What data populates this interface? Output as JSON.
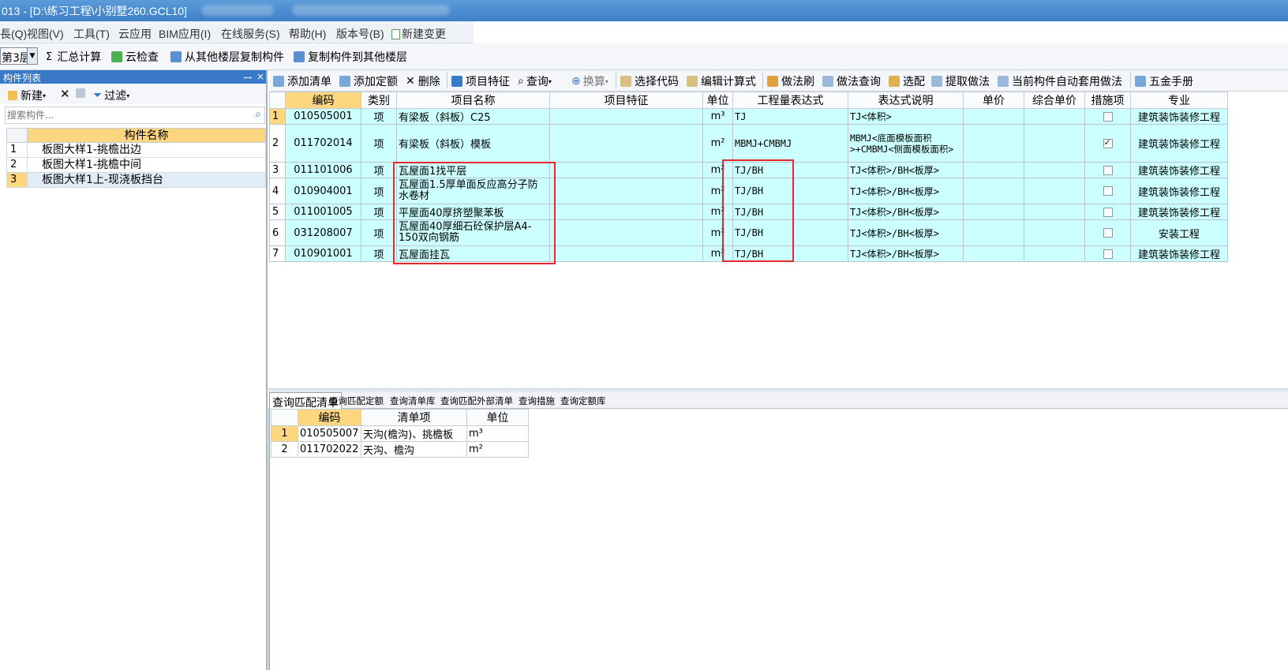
{
  "window": {
    "title": "013 - [D:\\练习工程\\小别墅260.GCL10]"
  },
  "menu": [
    "長(Q)",
    "视图(V)",
    "工具(T)",
    "云应用",
    "BIM应用(I)",
    "在线服务(S)",
    "帮助(H)",
    "版本号(B)",
    "新建变更"
  ],
  "toolbar1": {
    "floor": "第3层",
    "items": [
      "汇总计算",
      "云检查",
      "从其他楼层复制构件",
      "复制构件到其他楼层"
    ],
    "sum_symbol": "Σ"
  },
  "left_panel": {
    "title": "构件列表",
    "pin": "ꟷ",
    "close": "×",
    "new_label": "新建",
    "filter_label": "过滤",
    "search_placeholder": "搜索构件...",
    "column_header": "构件名称",
    "rows": [
      {
        "no": "1",
        "name": "板图大样1-挑檐出边"
      },
      {
        "no": "2",
        "name": "板图大样1-挑檐中间"
      },
      {
        "no": "3",
        "name": "板图大样1上-现浇板挡台"
      }
    ]
  },
  "main_toolbar": {
    "items": [
      "添加清单",
      "添加定额",
      "删除",
      "项目特征",
      "查询",
      "换算",
      "选择代码",
      "编辑计算式",
      "做法刷",
      "做法查询",
      "选配",
      "提取做法",
      "当前构件自动套用做法",
      "五金手册"
    ]
  },
  "main_grid": {
    "columns": [
      "编码",
      "类别",
      "项目名称",
      "项目特征",
      "单位",
      "工程量表达式",
      "表达式说明",
      "单价",
      "综合单价",
      "措施项",
      "专业"
    ],
    "rows": [
      {
        "no": "1",
        "code": "010505001",
        "type": "项",
        "name": "有梁板（斜板）C25",
        "feature": "",
        "unit": "m³",
        "expr": "TJ",
        "desc": "TJ<体积>",
        "price": "",
        "comp": "",
        "measure": false,
        "major": "建筑装饰装修工程"
      },
      {
        "no": "2",
        "code": "011702014",
        "type": "项",
        "name": "有梁板（斜板）模板",
        "feature": "",
        "unit": "m²",
        "expr": "MBMJ+CMBMJ",
        "desc": "MBMJ<底面模板面积>+CMBMJ<侧面模板面积>",
        "price": "",
        "comp": "",
        "measure": true,
        "major": "建筑装饰装修工程"
      },
      {
        "no": "3",
        "code": "011101006",
        "type": "项",
        "name": "瓦屋面1找平层",
        "feature": "",
        "unit": "m²",
        "expr": "TJ/BH",
        "desc": "TJ<体积>/BH<板厚>",
        "price": "",
        "comp": "",
        "measure": false,
        "major": "建筑装饰装修工程"
      },
      {
        "no": "4",
        "code": "010904001",
        "type": "项",
        "name": "瓦屋面1.5厚单面反应高分子防水卷材",
        "feature": "",
        "unit": "m²",
        "expr": "TJ/BH",
        "desc": "TJ<体积>/BH<板厚>",
        "price": "",
        "comp": "",
        "measure": false,
        "major": "建筑装饰装修工程"
      },
      {
        "no": "5",
        "code": "011001005",
        "type": "项",
        "name": "平屋面40厚挤塑聚苯板",
        "feature": "",
        "unit": "m²",
        "expr": "TJ/BH",
        "desc": "TJ<体积>/BH<板厚>",
        "price": "",
        "comp": "",
        "measure": false,
        "major": "建筑装饰装修工程"
      },
      {
        "no": "6",
        "code": "031208007",
        "type": "项",
        "name": "瓦屋面40厚细石砼保护层A4-150双向钢筋",
        "feature": "",
        "unit": "m²",
        "expr": "TJ/BH",
        "desc": "TJ<体积>/BH<板厚>",
        "price": "",
        "comp": "",
        "measure": false,
        "major": "安装工程"
      },
      {
        "no": "7",
        "code": "010901001",
        "type": "项",
        "name": "瓦屋面挂瓦",
        "feature": "",
        "unit": "m²",
        "expr": "TJ/BH",
        "desc": "TJ<体积>/BH<板厚>",
        "price": "",
        "comp": "",
        "measure": false,
        "major": "建筑装饰装修工程"
      }
    ]
  },
  "bottom_tabs": [
    "查询匹配清单",
    "查询匹配定额",
    "查询清单库",
    "查询匹配外部清单",
    "查询措施",
    "查询定额库"
  ],
  "bottom_grid": {
    "columns": [
      "编码",
      "清单项",
      "单位"
    ],
    "rows": [
      {
        "no": "1",
        "code": "010505007",
        "item": "天沟(檐沟)、挑檐板",
        "unit": "m³"
      },
      {
        "no": "2",
        "code": "011702022",
        "item": "天沟、檐沟",
        "unit": "m²"
      }
    ]
  },
  "colors": {
    "title_bar": "#3d7fc7",
    "grid_cell": "#ccffff",
    "header_highlight": "#ffd680",
    "highlight_box": "#e8262d"
  }
}
